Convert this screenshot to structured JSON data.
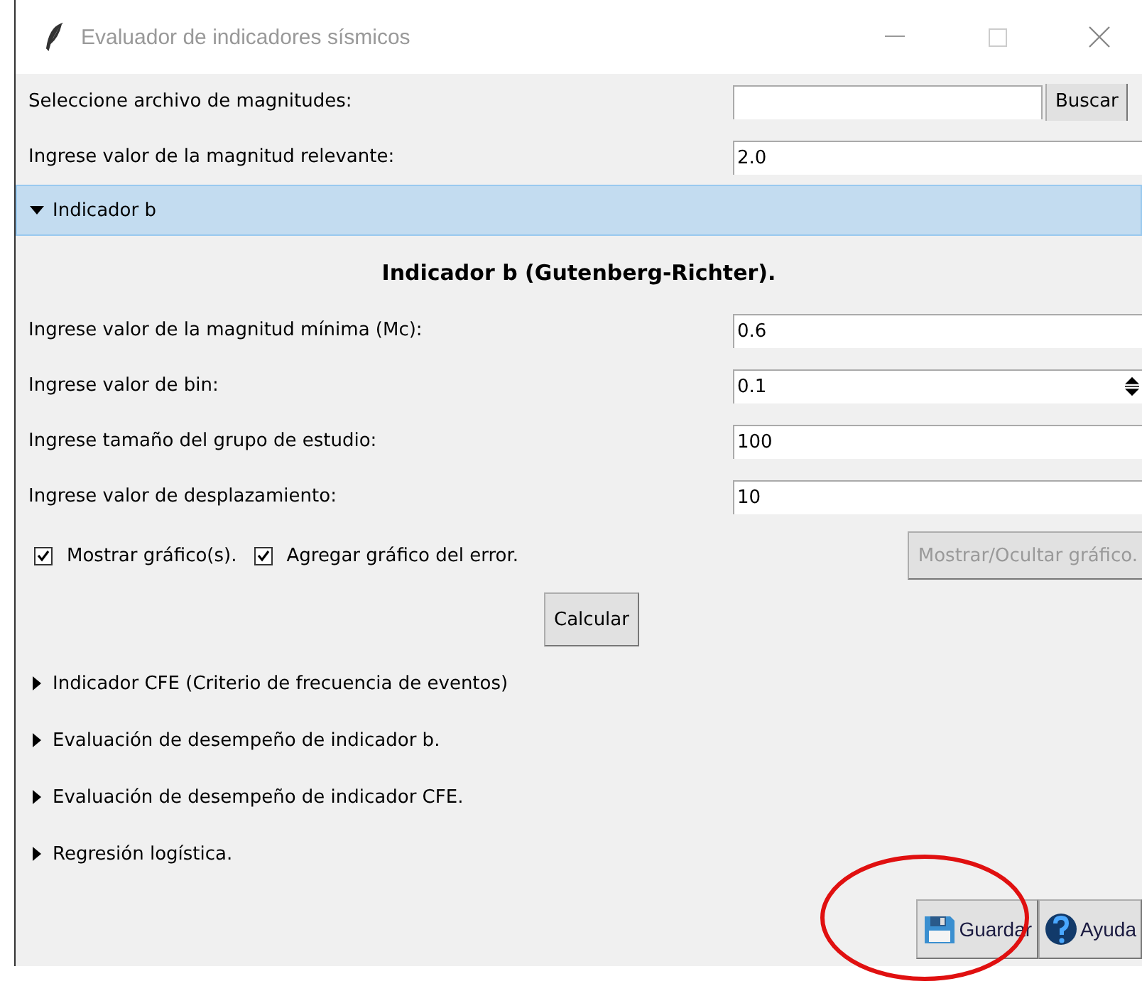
{
  "window": {
    "title": "Evaluador de indicadores sísmicos"
  },
  "top_fields": [
    {
      "kind": "file",
      "label": "Seleccione archivo de magnitudes:",
      "button": "Buscar"
    },
    {
      "kind": "entry",
      "label": "Ingrese valor de la magnitud relevante:",
      "value": "2.0"
    }
  ],
  "sections": [
    {
      "title": "Indicador b",
      "expanded": true,
      "heading": "Indicador b (Gutenberg-Richter).",
      "fields": [
        {
          "kind": "entry",
          "label": "Ingrese valor de la magnitud mínima (Mc):",
          "value": "0.6"
        },
        {
          "kind": "spinbox",
          "label": "Ingrese valor de bin:",
          "value": "0.1"
        },
        {
          "kind": "entry",
          "label": "Ingrese tamaño del grupo de estudio:",
          "value": "100"
        },
        {
          "kind": "entry",
          "label": "Ingrese valor de desplazamiento:",
          "value": "10"
        }
      ],
      "checkboxes": [
        {
          "label": "Mostrar gráfico(s).",
          "checked": true
        },
        {
          "label": "Agregar gráfico del error.",
          "checked": true
        }
      ],
      "toggle_button": {
        "label": "Mostrar/Ocultar gráfico.",
        "disabled": true
      },
      "action_button": {
        "label": "Calcular",
        "disabled": false
      }
    },
    {
      "title": "Indicador CFE (Criterio de frecuencia de eventos)",
      "expanded": false
    },
    {
      "title": "Evaluación de desempeño de indicador b.",
      "expanded": false
    },
    {
      "title": "Evaluación de desempeño de indicador CFE.",
      "expanded": false
    },
    {
      "title": "Regresión logística.",
      "expanded": false
    }
  ],
  "bottom_buttons": [
    {
      "kind": "save",
      "label": "Guardar"
    },
    {
      "kind": "help",
      "label": "Ayuda"
    }
  ]
}
